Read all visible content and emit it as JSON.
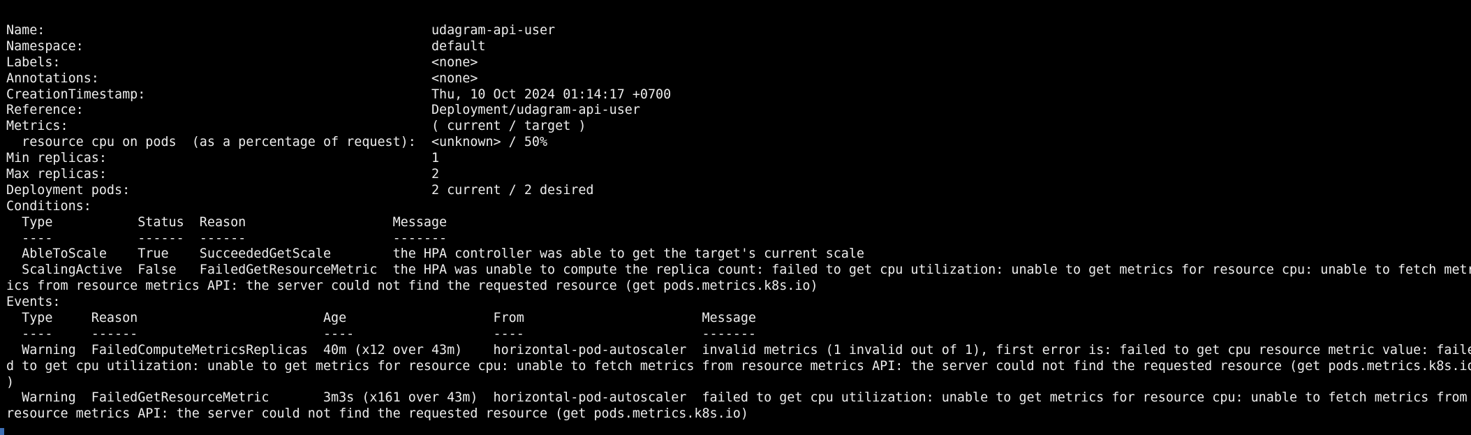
{
  "terminal": {
    "lines": [
      "Name:                                                  udagram-api-user",
      "Namespace:                                             default",
      "Labels:                                                <none>",
      "Annotations:                                           <none>",
      "CreationTimestamp:                                     Thu, 10 Oct 2024 01:14:17 +0700",
      "Reference:                                             Deployment/udagram-api-user",
      "Metrics:                                               ( current / target )",
      "  resource cpu on pods  (as a percentage of request):  <unknown> / 50%",
      "Min replicas:                                          1",
      "Max replicas:                                          2",
      "Deployment pods:                                       2 current / 2 desired",
      "Conditions:",
      "  Type           Status  Reason                   Message",
      "  ----           ------  ------                   -------",
      "  AbleToScale    True    SucceededGetScale        the HPA controller was able to get the target's current scale",
      "  ScalingActive  False   FailedGetResourceMetric  the HPA was unable to compute the replica count: failed to get cpu utilization: unable to get metrics for resource cpu: unable to fetch metr",
      "ics from resource metrics API: the server could not find the requested resource (get pods.metrics.k8s.io)",
      "Events:",
      "  Type     Reason                        Age                   From                       Message",
      "  ----     ------                        ----                  ----                       -------",
      "  Warning  FailedComputeMetricsReplicas  40m (x12 over 43m)    horizontal-pod-autoscaler  invalid metrics (1 invalid out of 1), first error is: failed to get cpu resource metric value: faile",
      "d to get cpu utilization: unable to get metrics for resource cpu: unable to fetch metrics from resource metrics API: the server could not find the requested resource (get pods.metrics.k8s.io",
      ")",
      "  Warning  FailedGetResourceMetric       3m3s (x161 over 43m)  horizontal-pod-autoscaler  failed to get cpu utilization: unable to get metrics for resource cpu: unable to fetch metrics from",
      "resource metrics API: the server could not find the requested resource (get pods.metrics.k8s.io)"
    ]
  }
}
